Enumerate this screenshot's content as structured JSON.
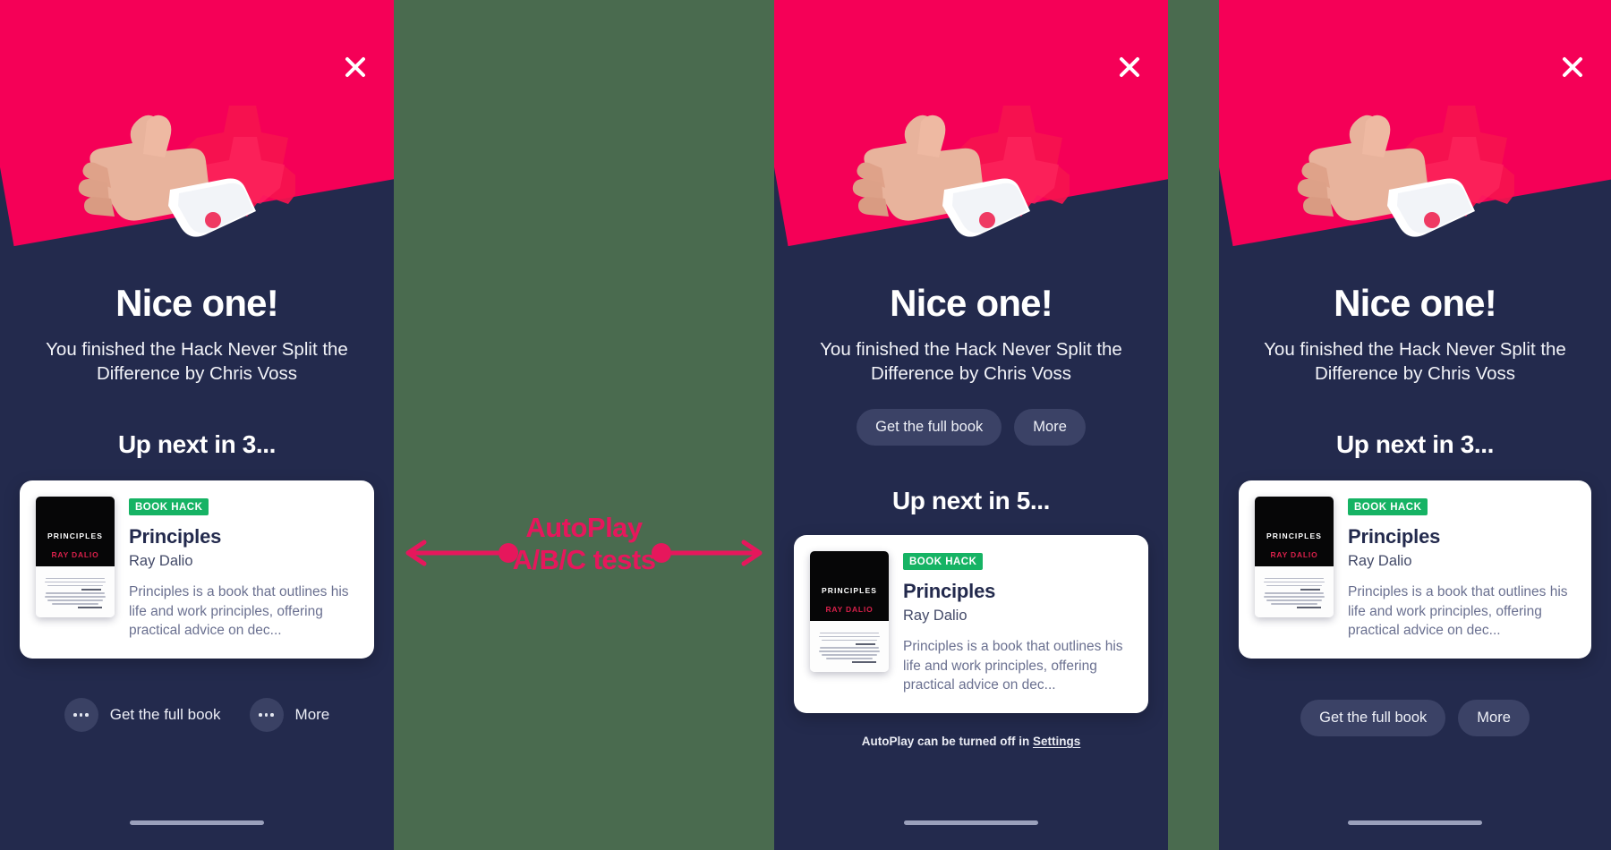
{
  "annotation": {
    "line1": "AutoPlay",
    "line2": "A/B/C tests",
    "color": "#e6175c"
  },
  "theme": {
    "panel_bg": "#232a4d",
    "hero_pink": "#f50057",
    "badge_green": "#16b364",
    "backdrop": "#4a6b4f"
  },
  "shared": {
    "title": "Nice one!",
    "subtitle": "You finished the Hack Never Split the Difference by Chris Voss",
    "close_icon": "close-icon",
    "illustration": "thumbs-up-hand-with-asterisk",
    "card": {
      "badge": "BOOK HACK",
      "title": "Principles",
      "author": "Ray Dalio",
      "description": "Principles is a book that outlines his life and work principles, offering practical advice on dec...",
      "cover": {
        "title": "PRINCIPLES",
        "author": "RAY DALIO"
      }
    },
    "actions": {
      "primary": "Get the full book",
      "secondary": "More"
    }
  },
  "variant_a": {
    "up_next": "Up next in 3...",
    "primary": "Get the full book",
    "secondary": "More",
    "menu_icon": "ellipsis-icon"
  },
  "variant_b": {
    "up_next": "Up next in 5...",
    "primary": "Get the full book",
    "secondary": "More",
    "note_prefix": "AutoPlay can be turned off in ",
    "note_link": "Settings"
  },
  "variant_c": {
    "up_next": "Up next in 3...",
    "primary": "Get the full book",
    "secondary": "More"
  }
}
